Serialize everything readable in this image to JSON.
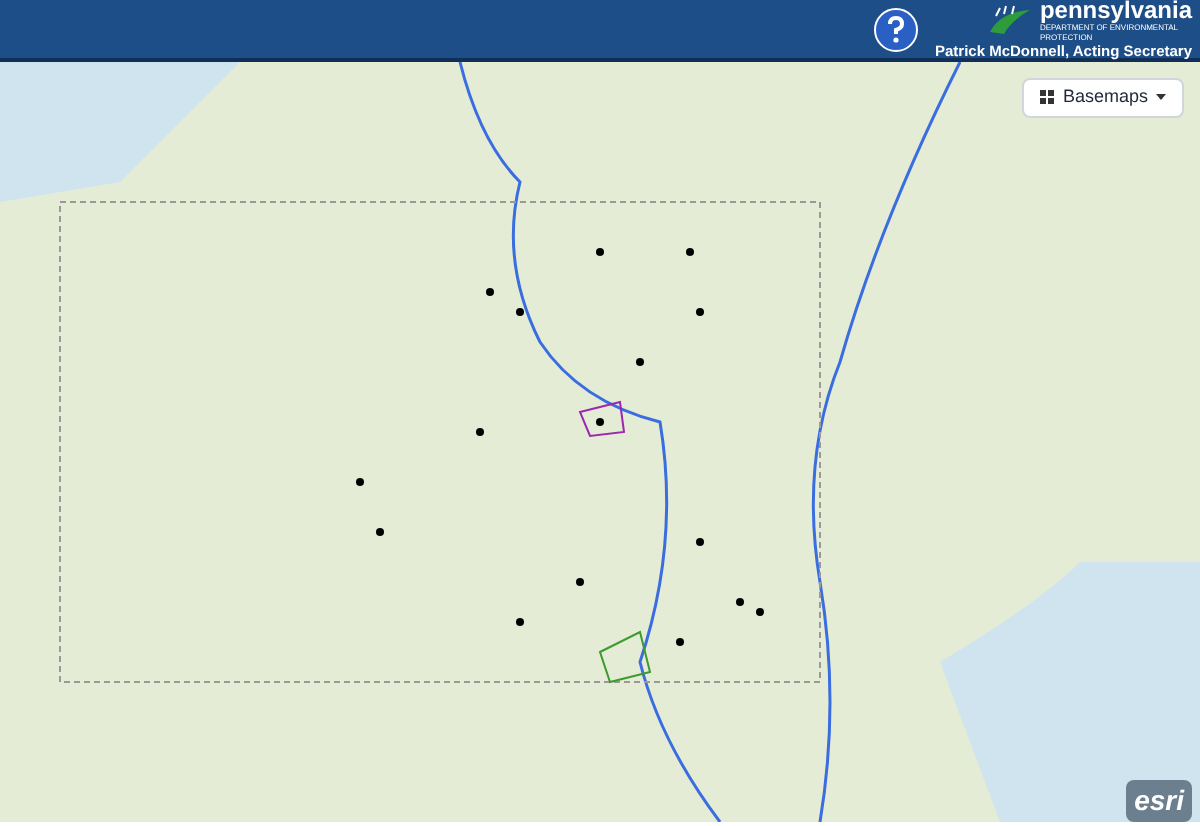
{
  "header": {
    "logo_name": "pennsylvania",
    "logo_subtitle": "DEPARTMENT OF ENVIRONMENTAL PROTECTION",
    "secretary": "Patrick McDonnell, Acting Secretary"
  },
  "basemaps_button": {
    "label": "Basemaps"
  },
  "attribution": "esri"
}
